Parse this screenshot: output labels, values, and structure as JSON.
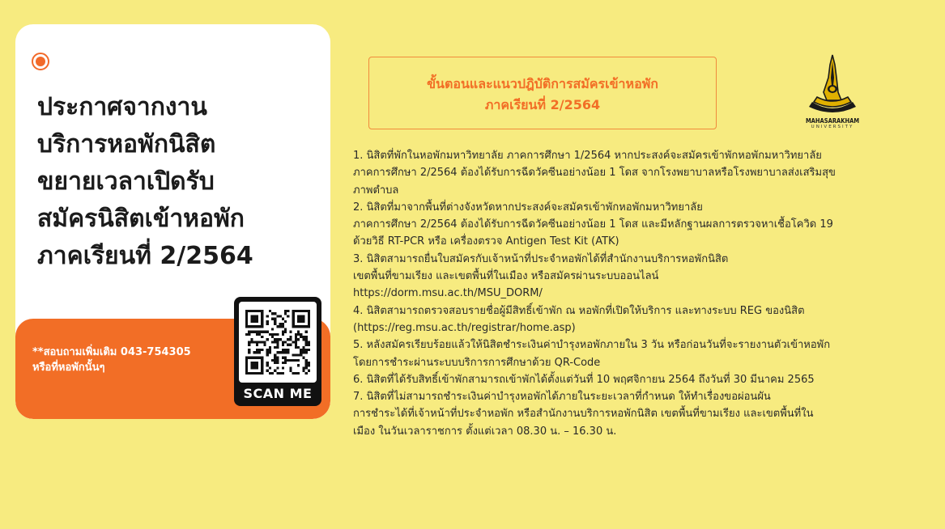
{
  "announcement": {
    "headline_lines": [
      "ประกาศจากงาน",
      "บริการหอพักนิสิต",
      "ขยายเวลาเปิดรับ",
      "สมัครนิสิตเข้าหอพัก",
      "ภาคเรียนที่ 2/2564"
    ],
    "contact": "**สอบถามเพิ่มเติม 043-754305\nหรือที่หอพักนั้นๆ",
    "qr_label": "SCAN ME"
  },
  "title_box": {
    "line1": "ขั้นตอนและแนวปฎิบัติการสมัครเข้าหอพัก",
    "line2": "ภาคเรียนที่ 2/2564"
  },
  "logo": {
    "name": "MAHASARAKHAM",
    "sub": "UNIVERSITY"
  },
  "steps": [
    "1. นิสิตที่พักในหอพักมหาวิทยาลัย ภาคการศึกษา 1/2564 หากประสงค์จะสมัครเข้าพักหอพักมหาวิทยาลัย",
    "ภาคการศึกษา 2/2564 ต้องได้รับการฉีดวัคซีนอย่างน้อย 1 โดส จากโรงพยาบาลหรือโรงพยาบาลส่งเสริมสุข",
    "ภาพตำบล",
    "2. นิสิตที่มาจากพื้นที่ต่างจังหวัดหากประสงค์จะสมัครเข้าพักหอพักมหาวิทยาลัย",
    "ภาคการศึกษา 2/2564 ต้องได้รับการฉีดวัคซีนอย่างน้อย 1 โดส และมีหลักฐานผลการตรวจหาเชื้อโควิด 19",
    "ด้วยวิธี RT-PCR หรือ เครื่องตรวจ Antigen Test Kit (ATK)",
    "3. นิสิตสามารถยื่นใบสมัครกับเจ้าหน้าที่ประจำหอพักได้ที่สำนักงานบริการหอพักนิสิต",
    "เขตพื้นที่ขามเรียง และเขตพื้นที่ในเมือง หรือสมัครผ่านระบบออนไลน์",
    "https://dorm.msu.ac.th/MSU_DORM/",
    "4. นิสิตสามารถตรวจสอบรายชื่อผู้มีสิทธิ์เข้าพัก ณ หอพักที่เปิดให้บริการ และทางระบบ REG ของนิสิต",
    "(https://reg.msu.ac.th/registrar/home.asp)",
    "5. หลังสมัครเรียบร้อยแล้วให้นิสิตชำระเงินค่าบำรุงหอพักภายใน 3 วัน หรือก่อนวันที่จะรายงานตัวเข้าหอพัก",
    "โดยการชำระผ่านระบบบริการการศึกษาด้วย QR-Code",
    "6. นิสิตที่ได้รับสิทธิ์เข้าพักสามารถเข้าพักได้ตั้งแต่วันที่ 10 พฤศจิกายน 2564 ถึงวันที่ 30 มีนาคม 2565",
    "7. นิสิตที่ไม่สามารถชำระเงินค่าบำรุงหอพักได้ภายในระยะเวลาที่กำหนด ให้ทำเรื่องขอผ่อนผัน",
    "การชำระได้ที่เจ้าหน้าที่ประจำหอพัก หรือสำนักงานบริการหอพักนิสิต เขตพื้นที่ขามเรียง และเขตพื้นที่ใน",
    "เมือง ในวันเวลาราชการ ตั้งแต่เวลา 08.30 น. – 16.30 น."
  ],
  "colors": {
    "background": "#f7eb80",
    "accent": "#f26e26",
    "card": "#ffffff"
  },
  "icons": {
    "bullet": "radio-dot-icon",
    "qr": "qr-code-icon",
    "logo": "university-crest-icon"
  }
}
